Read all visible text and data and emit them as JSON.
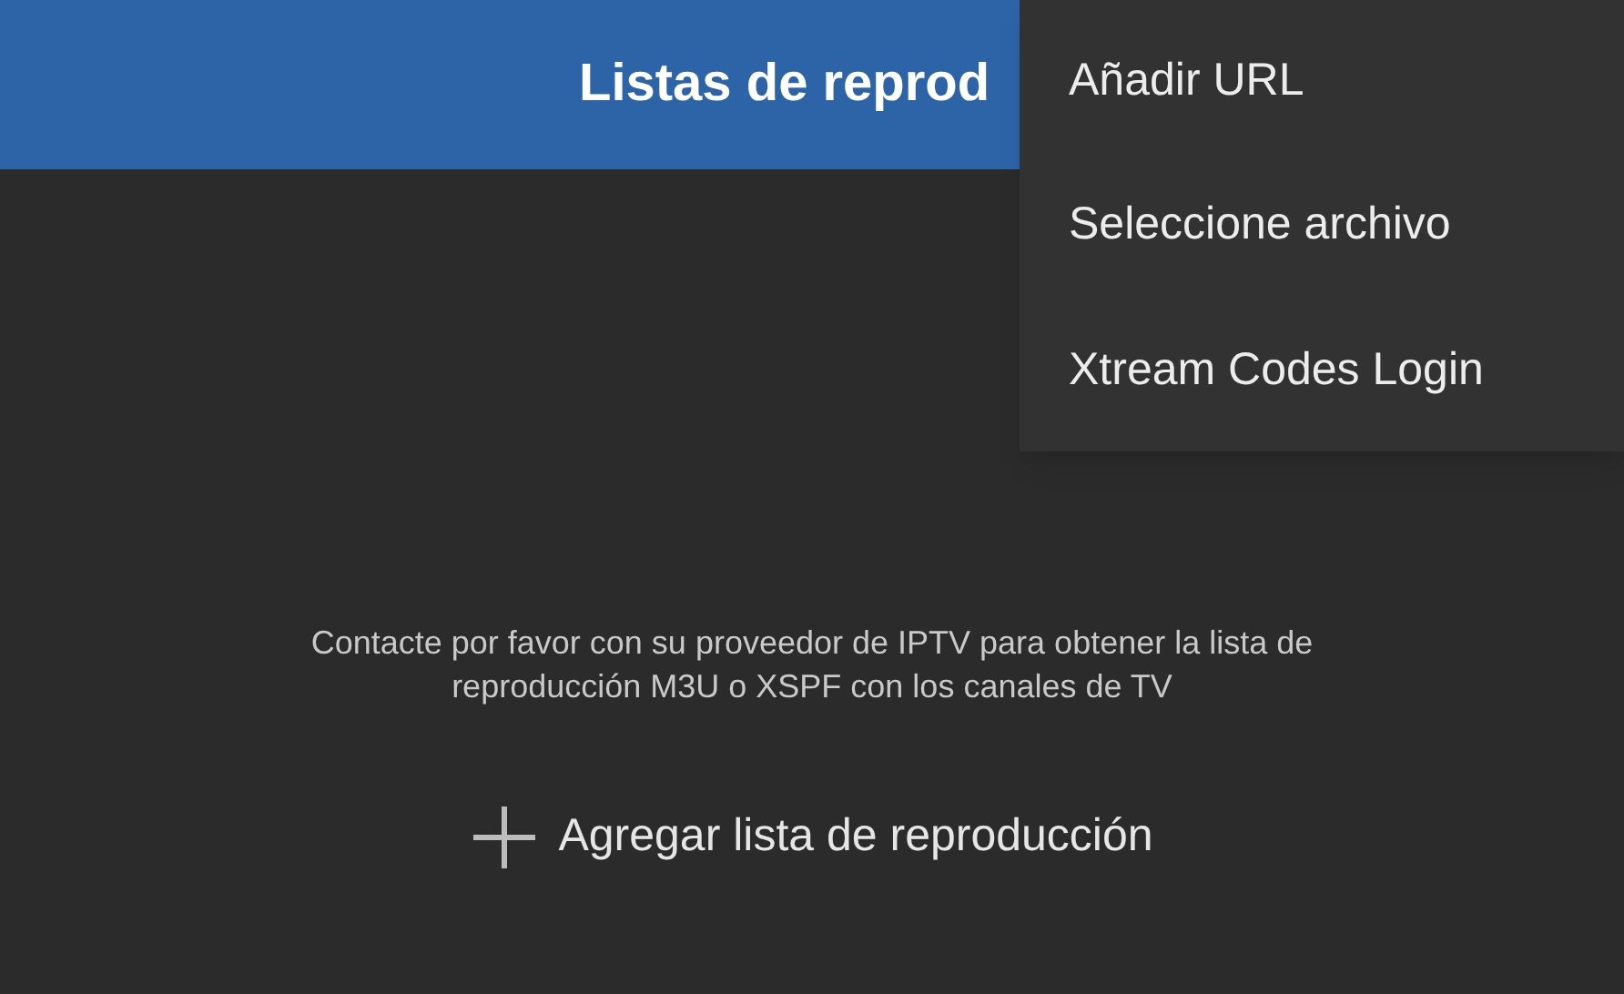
{
  "app_bar": {
    "title": "Listas de reprod"
  },
  "menu": {
    "items": [
      {
        "label": "Añadir URL"
      },
      {
        "label": "Seleccione archivo"
      },
      {
        "label": "Xtream Codes Login"
      }
    ]
  },
  "empty_state": {
    "message": "Contacte por favor con su proveedor de IPTV para obtener la lista de reproducción M3U o XSPF con los canales de TV",
    "add_button": "Agregar lista de reproducción"
  }
}
